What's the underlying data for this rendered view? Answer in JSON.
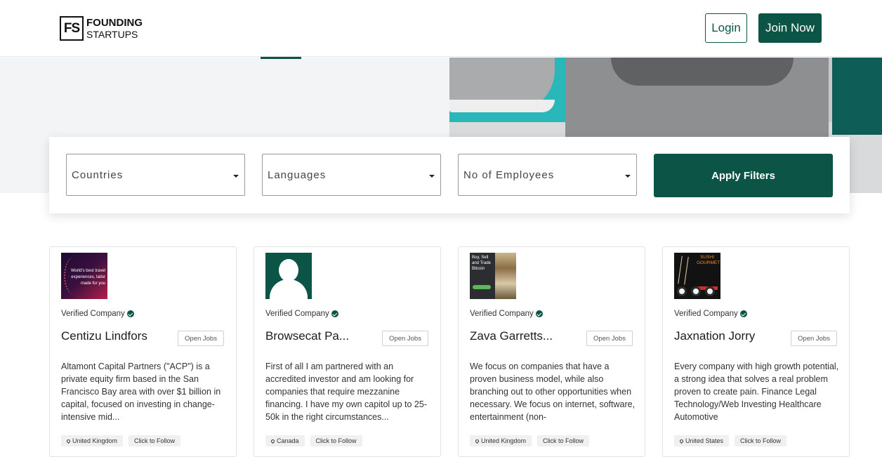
{
  "header": {
    "logo_mark": "FS",
    "logo_line1": "FOUNDING",
    "logo_line2": "STARTUPS",
    "login_label": "Login",
    "join_label": "Join Now"
  },
  "filters": {
    "countries": "Countries",
    "languages": "Languages",
    "employees": "No of Employees",
    "apply_label": "Apply Filters"
  },
  "cards": [
    {
      "verified": "Verified Company",
      "name": "Centizu Lindfors",
      "open_jobs": "Open Jobs",
      "description": "Altamont Capital Partners (\"ACP\") is a private equity firm based in the San Francisco Bay area with over $1 billion in capital, focused on investing in change-intensive mid...",
      "location": "United Kingdom",
      "follow": "Click to Follow",
      "thumb_text": "World's best travel experiences, tailor made for you"
    },
    {
      "verified": "Verified Company",
      "name": "Browsecat Pa...",
      "open_jobs": "Open Jobs",
      "description": "First of all I am partnered with an accredited investor and am looking for companies that require mezzanine financing. I have my own capitol up to 25-50k in the right circumstances...",
      "location": "Canada",
      "follow": "Click to Follow"
    },
    {
      "verified": "Verified Company",
      "name": "Zava Garretts...",
      "open_jobs": "Open Jobs",
      "description": "We focus on companies that have a proven business model, while also branching out to other opportunities when necessary. We focus on internet, software, entertainment (non-",
      "location": "United Kingdom",
      "follow": "Click to Follow",
      "thumb_text": "Buy, Sell and Trade Bitcoin"
    },
    {
      "verified": "Verified Company",
      "name": "Jaxnation Jorry",
      "open_jobs": "Open Jobs",
      "description": "Every company with high growth potential, a strong idea that solves a real problem proven to create pain. Finance Legal Technology/Web Investing Healthcare Automotive",
      "location": "United States",
      "follow": "Click to Follow",
      "thumb_text": "SUSHI GOURMET"
    }
  ],
  "colors": {
    "brand": "#0b5446"
  }
}
